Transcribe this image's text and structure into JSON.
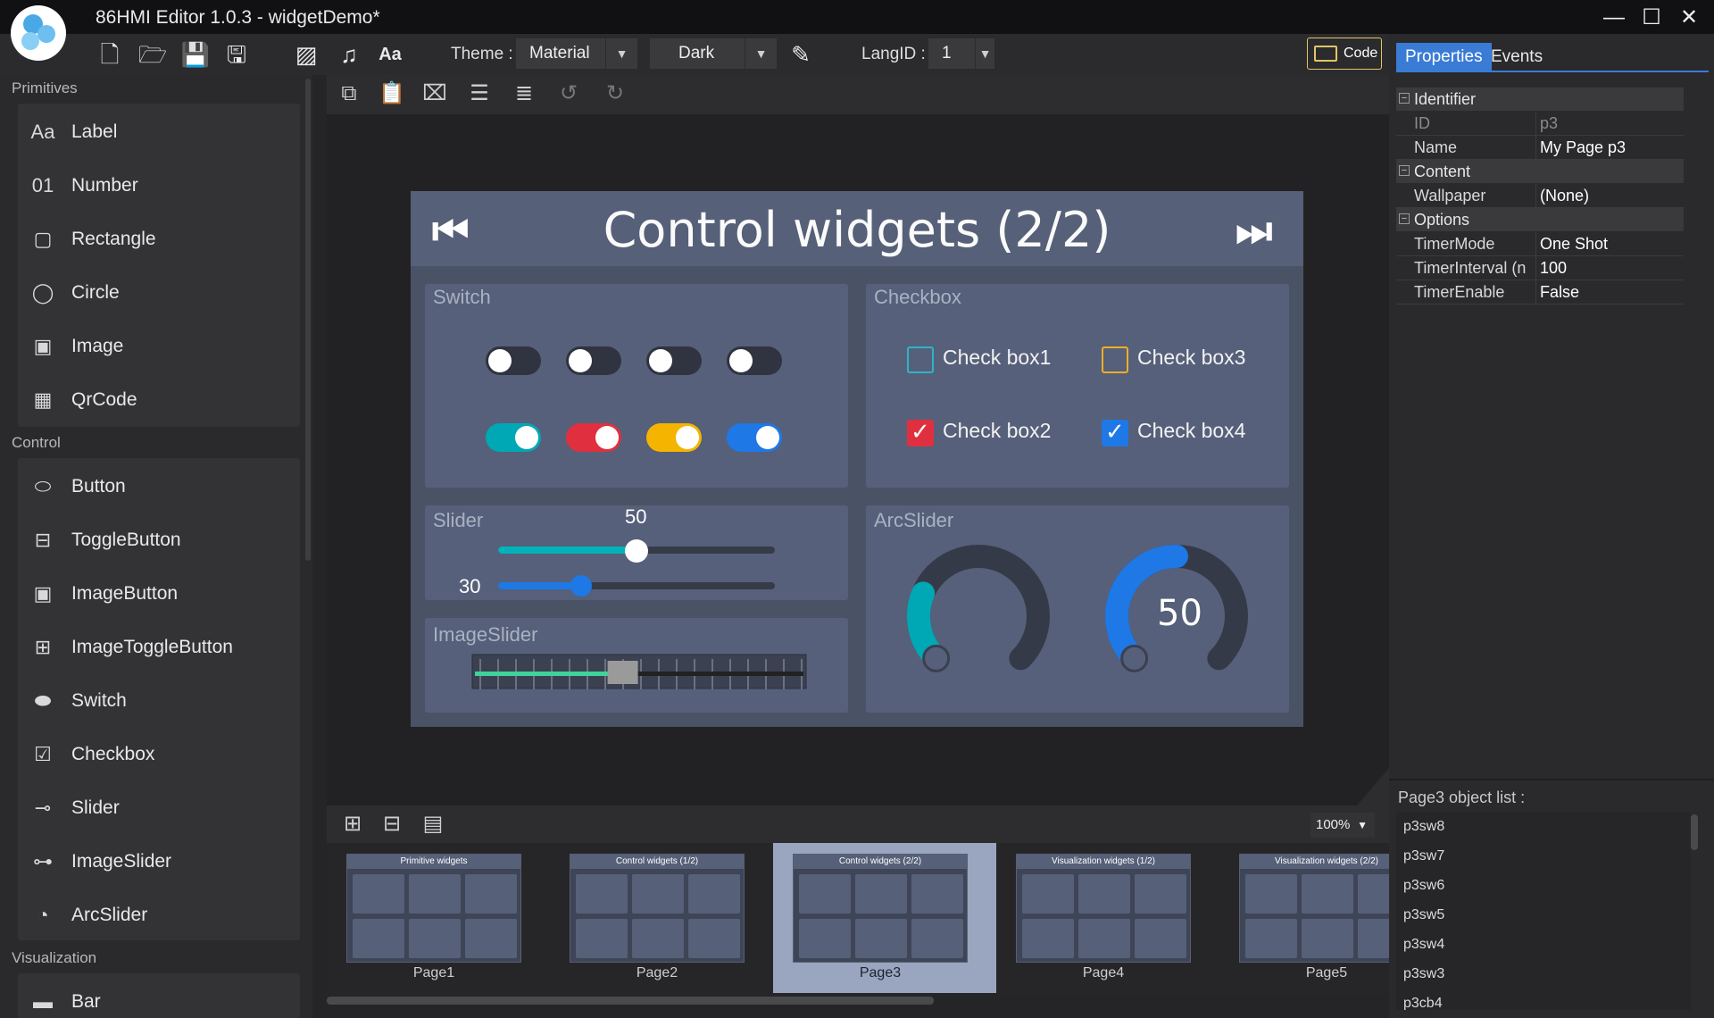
{
  "window": {
    "title": "86HMI Editor 1.0.3 - widgetDemo*"
  },
  "toolbar": {
    "theme_label": "Theme :",
    "theme_value": "Material",
    "mode_value": "Dark",
    "langid_label": "LangID :",
    "langid_value": "1",
    "code_label": "Code"
  },
  "sidebar": {
    "categories": [
      "Primitives",
      "Control",
      "Visualization"
    ],
    "primitives": [
      {
        "label": "Label",
        "icon": "label-icon",
        "glyph": "Aa"
      },
      {
        "label": "Number",
        "icon": "number-icon",
        "glyph": "01"
      },
      {
        "label": "Rectangle",
        "icon": "rectangle-icon",
        "glyph": "▢"
      },
      {
        "label": "Circle",
        "icon": "circle-icon",
        "glyph": "◯"
      },
      {
        "label": "Image",
        "icon": "image-icon",
        "glyph": "▣"
      },
      {
        "label": "QrCode",
        "icon": "qrcode-icon",
        "glyph": "▦"
      }
    ],
    "control": [
      {
        "label": "Button",
        "icon": "button-icon",
        "glyph": "⬭"
      },
      {
        "label": "ToggleButton",
        "icon": "togglebutton-icon",
        "glyph": "⊟"
      },
      {
        "label": "ImageButton",
        "icon": "imagebutton-icon",
        "glyph": "▣"
      },
      {
        "label": "ImageToggleButton",
        "icon": "imagetogglebutton-icon",
        "glyph": "⊞"
      },
      {
        "label": "Switch",
        "icon": "switch-icon",
        "glyph": "⬬"
      },
      {
        "label": "Checkbox",
        "icon": "checkbox-icon",
        "glyph": "☑"
      },
      {
        "label": "Slider",
        "icon": "slider-icon",
        "glyph": "⊸"
      },
      {
        "label": "ImageSlider",
        "icon": "imageslider-icon",
        "glyph": "⊶"
      },
      {
        "label": "ArcSlider",
        "icon": "arcslider-icon",
        "glyph": "◔"
      }
    ],
    "visualization": [
      {
        "label": "Bar",
        "icon": "bar-icon",
        "glyph": "▬"
      }
    ]
  },
  "page": {
    "title": "Control widgets (2/2)",
    "switch_title": "Switch",
    "checkbox_title": "Checkbox",
    "slider_title": "Slider",
    "arcslider_title": "ArcSlider",
    "imageslider_title": "ImageSlider",
    "switches_off": [
      false,
      false,
      false,
      false
    ],
    "switches_on": [
      "#00a8b5",
      "#e0303f",
      "#f5b400",
      "#1e78e6"
    ],
    "checkboxes": [
      {
        "label": "Check box1",
        "checked": false,
        "color": "#2fb3c8"
      },
      {
        "label": "Check box3",
        "checked": false,
        "color": "#f0ae27"
      },
      {
        "label": "Check box2",
        "checked": true,
        "color": "#e0303f"
      },
      {
        "label": "Check box4",
        "checked": true,
        "color": "#1e78e6"
      }
    ],
    "slider1": {
      "value": "50",
      "fraction": 0.5,
      "color": "#00b3b8"
    },
    "slider2": {
      "value": "30",
      "fraction": 0.3,
      "color": "#1e78e6"
    },
    "imageslider_fraction": 0.45,
    "arc1": {
      "fraction": 0.25,
      "color": "#00a8b5"
    },
    "arc2": {
      "value": "50",
      "fraction": 0.5,
      "color": "#1e78e6"
    }
  },
  "thumbnails": {
    "zoom": "100%",
    "pages": [
      {
        "label": "Page1",
        "title": "Primitive widgets",
        "selected": false
      },
      {
        "label": "Page2",
        "title": "Control widgets (1/2)",
        "selected": false
      },
      {
        "label": "Page3",
        "title": "Control widgets (2/2)",
        "selected": true
      },
      {
        "label": "Page4",
        "title": "Visualization widgets (1/2)",
        "selected": false
      },
      {
        "label": "Page5",
        "title": "Visualization widgets (2/2)",
        "selected": false
      }
    ]
  },
  "properties": {
    "tabs": [
      "Properties",
      "Events"
    ],
    "sections": [
      {
        "name": "Identifier",
        "rows": [
          {
            "key": "ID",
            "value": "p3",
            "dim": true
          },
          {
            "key": "Name",
            "value": "My Page p3"
          }
        ]
      },
      {
        "name": "Content",
        "rows": [
          {
            "key": "Wallpaper",
            "value": "(None)"
          }
        ]
      },
      {
        "name": "Options",
        "rows": [
          {
            "key": "TimerMode",
            "value": "One Shot"
          },
          {
            "key": "TimerInterval (n",
            "value": "100"
          },
          {
            "key": "TimerEnable",
            "value": "False"
          }
        ]
      }
    ],
    "objlist_title": "Page3 object list :",
    "objects": [
      "p3sw8",
      "p3sw7",
      "p3sw6",
      "p3sw5",
      "p3sw4",
      "p3sw3",
      "p3cb4"
    ]
  }
}
